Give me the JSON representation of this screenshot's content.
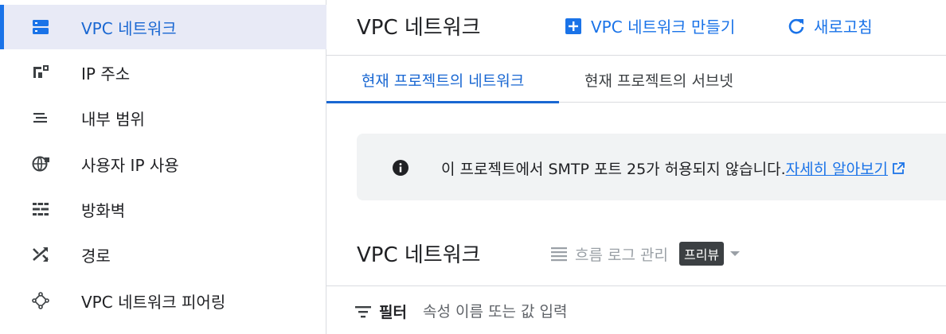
{
  "sidebar": {
    "items": [
      {
        "label": "VPC 네트워크",
        "icon": "vpc-network-icon",
        "active": true
      },
      {
        "label": "IP 주소",
        "icon": "ip-address-icon",
        "active": false
      },
      {
        "label": "내부 범위",
        "icon": "internal-ranges-icon",
        "active": false
      },
      {
        "label": "사용자 IP 사용",
        "icon": "globe-icon",
        "active": false
      },
      {
        "label": "방화벽",
        "icon": "firewall-icon",
        "active": false
      },
      {
        "label": "경로",
        "icon": "routes-icon",
        "active": false
      },
      {
        "label": "VPC 네트워크 피어링",
        "icon": "peering-icon",
        "active": false
      }
    ]
  },
  "header": {
    "title": "VPC 네트워크",
    "create_label": "VPC 네트워크 만들기",
    "refresh_label": "새로고침"
  },
  "tabs": [
    {
      "label": "현재 프로젝트의 네트워크",
      "active": true
    },
    {
      "label": "현재 프로젝트의 서브넷",
      "active": false
    }
  ],
  "banner": {
    "text": "이 프로젝트에서 SMTP 포트 25가 허용되지 않습니다.",
    "link": "자세히 알아보기"
  },
  "section": {
    "title": "VPC 네트워크",
    "flow_log_label": "흐름 로그 관리",
    "badge": "프리뷰"
  },
  "filter": {
    "label": "필터",
    "placeholder": "속성 이름 또는 값 입력"
  },
  "colors": {
    "accent": "#1a73e8",
    "active_bg": "#e8eaf6",
    "badge_bg": "#3c4043",
    "banner_bg": "#f1f3f4"
  }
}
